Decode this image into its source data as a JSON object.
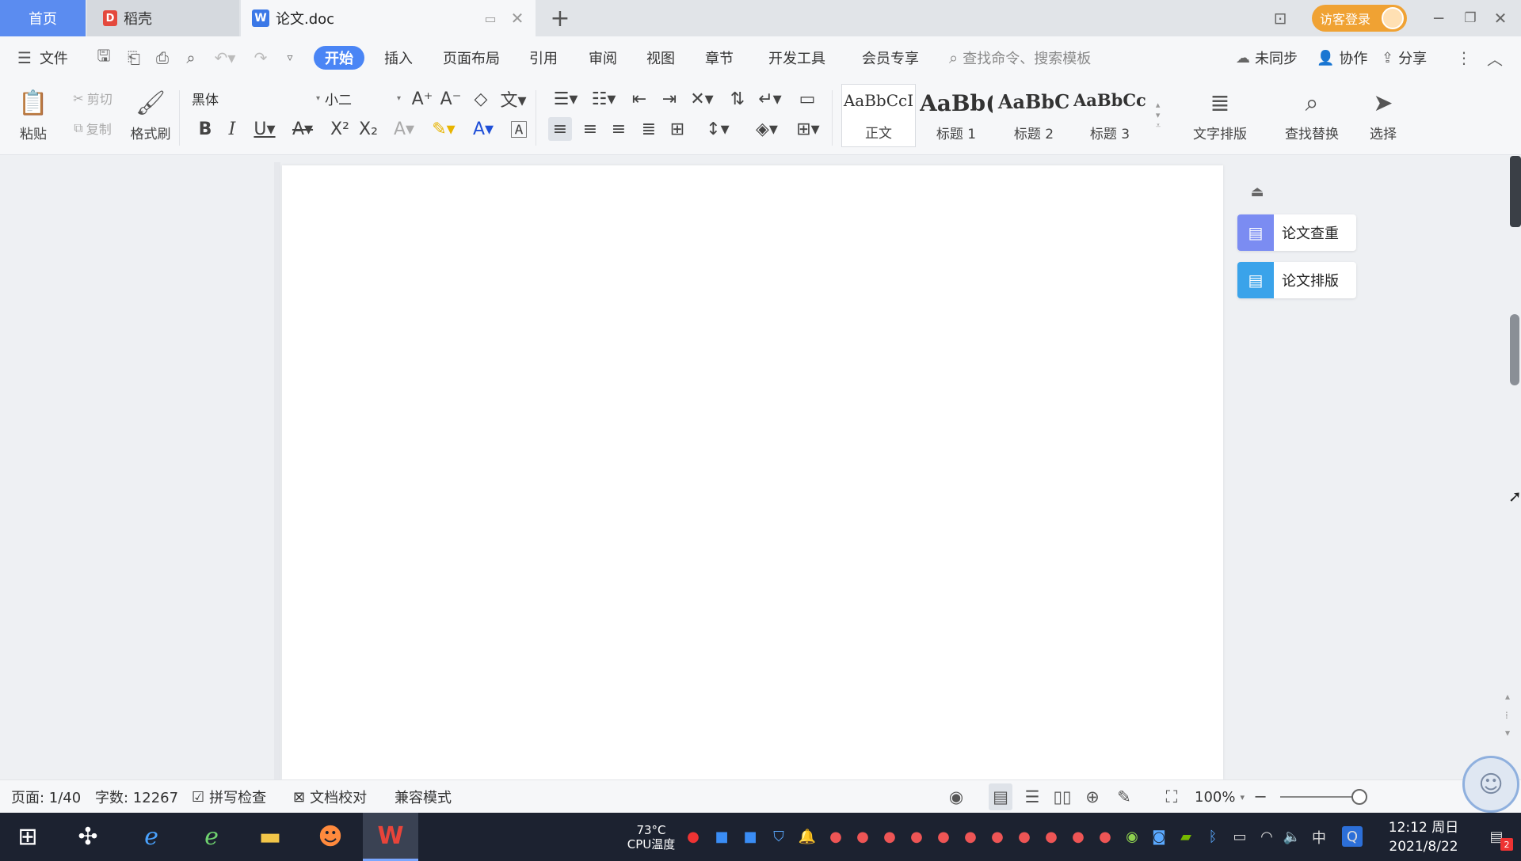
{
  "tabs": {
    "home": "首页",
    "daoke": "稻壳",
    "doc": "论文.doc"
  },
  "titlebar": {
    "login_label": "访客登录"
  },
  "menu": {
    "file": "文件",
    "items": [
      "开始",
      "插入",
      "页面布局",
      "引用",
      "审阅",
      "视图",
      "章节",
      "开发工具",
      "会员专享"
    ],
    "active": "开始",
    "search_placeholder": "查找命令、搜索模板",
    "sync": "未同步",
    "collab": "协作",
    "share": "分享"
  },
  "ribbon": {
    "paste": "粘贴",
    "cut": "剪切",
    "copy": "复制",
    "format_painter": "格式刷",
    "font_name": "黑体",
    "font_size": "小二",
    "styles": [
      {
        "sample": "AaBbCcI",
        "name": "正文"
      },
      {
        "sample": "AaBb(",
        "name": "标题 1"
      },
      {
        "sample": "AaBbC",
        "name": "标题 2"
      },
      {
        "sample": "AaBbCcl",
        "name": "标题 3"
      }
    ],
    "text_layout": "文字排版",
    "find_replace": "查找替换",
    "select": "选择"
  },
  "side_panel": {
    "check": "论文查重",
    "layout": "论文排版"
  },
  "status": {
    "page": "页面: 1/40",
    "words": "字数: 12267",
    "spell": "拼写检查",
    "proof": "文档校对",
    "compat": "兼容模式",
    "zoom": "100%"
  },
  "taskbar": {
    "temp": "73°C",
    "temp_label": "CPU温度",
    "ime": "中",
    "time": "12:12 周日",
    "date": "2021/8/22",
    "notif_count": "2"
  },
  "colors": {
    "accent": "#4a85f5",
    "home_tab": "#5b8cf0",
    "login": "#f0a233",
    "taskbar": "#1c2230"
  }
}
